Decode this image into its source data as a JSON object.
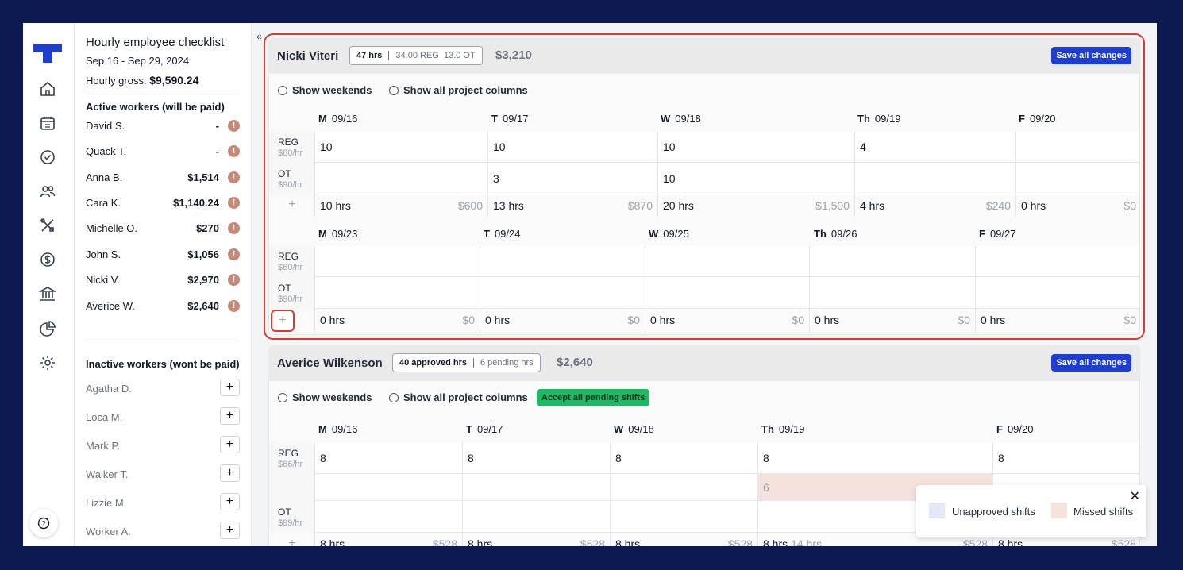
{
  "sidebar": {
    "title": "Hourly employee checklist",
    "dates": "Sep 16 - Sep 29, 2024",
    "gross_label": "Hourly gross:",
    "gross_value": "$9,590.24",
    "active_heading": "Active workers (will be paid)",
    "active": [
      {
        "name": "David S.",
        "amount": "-"
      },
      {
        "name": "Quack T.",
        "amount": "-"
      },
      {
        "name": "Anna B.",
        "amount": "$1,514"
      },
      {
        "name": "Cara K.",
        "amount": "$1,140.24"
      },
      {
        "name": "Michelle O.",
        "amount": "$270"
      },
      {
        "name": "John S.",
        "amount": "$1,056"
      },
      {
        "name": "Nicki V.",
        "amount": "$2,970"
      },
      {
        "name": "Averice W.",
        "amount": "$2,640"
      }
    ],
    "warn_glyph": "!",
    "inactive_heading": "Inactive workers (wont be paid)",
    "inactive": [
      "Agatha D.",
      "Loca M.",
      "Mark P.",
      "Walker T.",
      "Lizzie M.",
      "Worker A."
    ],
    "add_glyph": "+"
  },
  "rail": {
    "icons": [
      "home-icon",
      "calendar-icon",
      "check-circle-icon",
      "users-icon",
      "tools-icon",
      "dollar-icon",
      "bank-icon",
      "pie-chart-icon",
      "gear-icon"
    ],
    "help_glyph": "?"
  },
  "main": {
    "collapse_glyph": "«",
    "save_label": "Save all changes",
    "show_weekends": "Show weekends",
    "show_projects": "Show all project columns",
    "plus_glyph": "+"
  },
  "card1": {
    "name": "Nicki Viteri",
    "hrs": "47 hrs",
    "reg": "34.00 REG",
    "ot": "13.0 OT",
    "amount": "$3,210",
    "week1": {
      "days": [
        {
          "d": "M",
          "date": "09/16"
        },
        {
          "d": "T",
          "date": "09/17"
        },
        {
          "d": "W",
          "date": "09/18"
        },
        {
          "d": "Th",
          "date": "09/19"
        },
        {
          "d": "F",
          "date": "09/20"
        }
      ],
      "reg_label": "REG",
      "reg_rate": "$60/hr",
      "ot_label": "OT",
      "ot_rate": "$90/hr",
      "reg": [
        "10",
        "10",
        "10",
        "4",
        ""
      ],
      "ot": [
        "",
        "3",
        "10",
        "",
        ""
      ],
      "tot_hrs": [
        "10 hrs",
        "13 hrs",
        "20 hrs",
        "4 hrs",
        "0 hrs"
      ],
      "tot_amt": [
        "$600",
        "$870",
        "$1,500",
        "$240",
        "$0"
      ]
    },
    "week2": {
      "days": [
        {
          "d": "M",
          "date": "09/23"
        },
        {
          "d": "T",
          "date": "09/24"
        },
        {
          "d": "W",
          "date": "09/25"
        },
        {
          "d": "Th",
          "date": "09/26"
        },
        {
          "d": "F",
          "date": "09/27"
        }
      ],
      "reg_label": "REG",
      "reg_rate": "$60/hr",
      "ot_label": "OT",
      "ot_rate": "$90/hr",
      "tot_hrs": [
        "0 hrs",
        "0 hrs",
        "0 hrs",
        "0 hrs",
        "0 hrs"
      ],
      "tot_amt": [
        "$0",
        "$0",
        "$0",
        "$0",
        "$0"
      ]
    }
  },
  "card2": {
    "name": "Averice Wilkenson",
    "approved": "40 approved hrs",
    "pending": "6 pending hrs",
    "amount": "$2,640",
    "accept_label": "Accept all pending shifts",
    "days": [
      {
        "d": "M",
        "date": "09/16"
      },
      {
        "d": "T",
        "date": "09/17"
      },
      {
        "d": "W",
        "date": "09/18"
      },
      {
        "d": "Th",
        "date": "09/19"
      },
      {
        "d": "F",
        "date": "09/20"
      }
    ],
    "reg_label": "REG",
    "reg_rate": "$66/hr",
    "ot_label": "OT",
    "ot_rate": "$99/hr",
    "reg": [
      "8",
      "8",
      "8",
      "8",
      "8"
    ],
    "missed_value": "6",
    "tot_hrs": [
      "8 hrs",
      "8 hrs",
      "8 hrs",
      "8 hrs",
      "8 hrs"
    ],
    "pending_hrs": "14 hrs",
    "tot_amt": [
      "$528",
      "$528",
      "$528",
      "$528",
      "$528"
    ]
  },
  "legend": {
    "close_glyph": "✕",
    "unapproved": "Unapproved shifts",
    "missed": "Missed shifts",
    "unapproved_color": "#e3e8f8",
    "missed_color": "#f6e2dc"
  }
}
